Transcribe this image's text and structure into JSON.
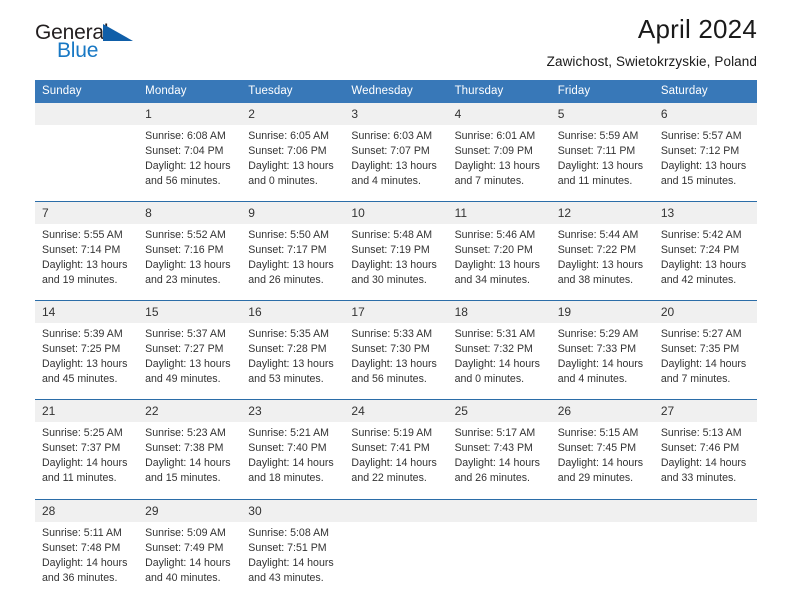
{
  "brand": {
    "name_part1": "General",
    "name_part2": "Blue",
    "logo_icon": "triangle-icon",
    "color_dark": "#231f20",
    "color_blue": "#1878c4"
  },
  "header": {
    "title": "April 2024",
    "subtitle": "Zawichost, Swietokrzyskie, Poland"
  },
  "calendar": {
    "header_bg": "#3878b8",
    "daynum_bg": "#f0f0f0",
    "weekday_headers": [
      "Sunday",
      "Monday",
      "Tuesday",
      "Wednesday",
      "Thursday",
      "Friday",
      "Saturday"
    ],
    "weeks": [
      {
        "days": [
          {
            "num": "",
            "sunrise": "",
            "sunset": "",
            "daylight_1": "",
            "daylight_2": ""
          },
          {
            "num": "1",
            "sunrise": "Sunrise: 6:08 AM",
            "sunset": "Sunset: 7:04 PM",
            "daylight_1": "Daylight: 12 hours",
            "daylight_2": "and 56 minutes."
          },
          {
            "num": "2",
            "sunrise": "Sunrise: 6:05 AM",
            "sunset": "Sunset: 7:06 PM",
            "daylight_1": "Daylight: 13 hours",
            "daylight_2": "and 0 minutes."
          },
          {
            "num": "3",
            "sunrise": "Sunrise: 6:03 AM",
            "sunset": "Sunset: 7:07 PM",
            "daylight_1": "Daylight: 13 hours",
            "daylight_2": "and 4 minutes."
          },
          {
            "num": "4",
            "sunrise": "Sunrise: 6:01 AM",
            "sunset": "Sunset: 7:09 PM",
            "daylight_1": "Daylight: 13 hours",
            "daylight_2": "and 7 minutes."
          },
          {
            "num": "5",
            "sunrise": "Sunrise: 5:59 AM",
            "sunset": "Sunset: 7:11 PM",
            "daylight_1": "Daylight: 13 hours",
            "daylight_2": "and 11 minutes."
          },
          {
            "num": "6",
            "sunrise": "Sunrise: 5:57 AM",
            "sunset": "Sunset: 7:12 PM",
            "daylight_1": "Daylight: 13 hours",
            "daylight_2": "and 15 minutes."
          }
        ]
      },
      {
        "days": [
          {
            "num": "7",
            "sunrise": "Sunrise: 5:55 AM",
            "sunset": "Sunset: 7:14 PM",
            "daylight_1": "Daylight: 13 hours",
            "daylight_2": "and 19 minutes."
          },
          {
            "num": "8",
            "sunrise": "Sunrise: 5:52 AM",
            "sunset": "Sunset: 7:16 PM",
            "daylight_1": "Daylight: 13 hours",
            "daylight_2": "and 23 minutes."
          },
          {
            "num": "9",
            "sunrise": "Sunrise: 5:50 AM",
            "sunset": "Sunset: 7:17 PM",
            "daylight_1": "Daylight: 13 hours",
            "daylight_2": "and 26 minutes."
          },
          {
            "num": "10",
            "sunrise": "Sunrise: 5:48 AM",
            "sunset": "Sunset: 7:19 PM",
            "daylight_1": "Daylight: 13 hours",
            "daylight_2": "and 30 minutes."
          },
          {
            "num": "11",
            "sunrise": "Sunrise: 5:46 AM",
            "sunset": "Sunset: 7:20 PM",
            "daylight_1": "Daylight: 13 hours",
            "daylight_2": "and 34 minutes."
          },
          {
            "num": "12",
            "sunrise": "Sunrise: 5:44 AM",
            "sunset": "Sunset: 7:22 PM",
            "daylight_1": "Daylight: 13 hours",
            "daylight_2": "and 38 minutes."
          },
          {
            "num": "13",
            "sunrise": "Sunrise: 5:42 AM",
            "sunset": "Sunset: 7:24 PM",
            "daylight_1": "Daylight: 13 hours",
            "daylight_2": "and 42 minutes."
          }
        ]
      },
      {
        "days": [
          {
            "num": "14",
            "sunrise": "Sunrise: 5:39 AM",
            "sunset": "Sunset: 7:25 PM",
            "daylight_1": "Daylight: 13 hours",
            "daylight_2": "and 45 minutes."
          },
          {
            "num": "15",
            "sunrise": "Sunrise: 5:37 AM",
            "sunset": "Sunset: 7:27 PM",
            "daylight_1": "Daylight: 13 hours",
            "daylight_2": "and 49 minutes."
          },
          {
            "num": "16",
            "sunrise": "Sunrise: 5:35 AM",
            "sunset": "Sunset: 7:28 PM",
            "daylight_1": "Daylight: 13 hours",
            "daylight_2": "and 53 minutes."
          },
          {
            "num": "17",
            "sunrise": "Sunrise: 5:33 AM",
            "sunset": "Sunset: 7:30 PM",
            "daylight_1": "Daylight: 13 hours",
            "daylight_2": "and 56 minutes."
          },
          {
            "num": "18",
            "sunrise": "Sunrise: 5:31 AM",
            "sunset": "Sunset: 7:32 PM",
            "daylight_1": "Daylight: 14 hours",
            "daylight_2": "and 0 minutes."
          },
          {
            "num": "19",
            "sunrise": "Sunrise: 5:29 AM",
            "sunset": "Sunset: 7:33 PM",
            "daylight_1": "Daylight: 14 hours",
            "daylight_2": "and 4 minutes."
          },
          {
            "num": "20",
            "sunrise": "Sunrise: 5:27 AM",
            "sunset": "Sunset: 7:35 PM",
            "daylight_1": "Daylight: 14 hours",
            "daylight_2": "and 7 minutes."
          }
        ]
      },
      {
        "days": [
          {
            "num": "21",
            "sunrise": "Sunrise: 5:25 AM",
            "sunset": "Sunset: 7:37 PM",
            "daylight_1": "Daylight: 14 hours",
            "daylight_2": "and 11 minutes."
          },
          {
            "num": "22",
            "sunrise": "Sunrise: 5:23 AM",
            "sunset": "Sunset: 7:38 PM",
            "daylight_1": "Daylight: 14 hours",
            "daylight_2": "and 15 minutes."
          },
          {
            "num": "23",
            "sunrise": "Sunrise: 5:21 AM",
            "sunset": "Sunset: 7:40 PM",
            "daylight_1": "Daylight: 14 hours",
            "daylight_2": "and 18 minutes."
          },
          {
            "num": "24",
            "sunrise": "Sunrise: 5:19 AM",
            "sunset": "Sunset: 7:41 PM",
            "daylight_1": "Daylight: 14 hours",
            "daylight_2": "and 22 minutes."
          },
          {
            "num": "25",
            "sunrise": "Sunrise: 5:17 AM",
            "sunset": "Sunset: 7:43 PM",
            "daylight_1": "Daylight: 14 hours",
            "daylight_2": "and 26 minutes."
          },
          {
            "num": "26",
            "sunrise": "Sunrise: 5:15 AM",
            "sunset": "Sunset: 7:45 PM",
            "daylight_1": "Daylight: 14 hours",
            "daylight_2": "and 29 minutes."
          },
          {
            "num": "27",
            "sunrise": "Sunrise: 5:13 AM",
            "sunset": "Sunset: 7:46 PM",
            "daylight_1": "Daylight: 14 hours",
            "daylight_2": "and 33 minutes."
          }
        ]
      },
      {
        "days": [
          {
            "num": "28",
            "sunrise": "Sunrise: 5:11 AM",
            "sunset": "Sunset: 7:48 PM",
            "daylight_1": "Daylight: 14 hours",
            "daylight_2": "and 36 minutes."
          },
          {
            "num": "29",
            "sunrise": "Sunrise: 5:09 AM",
            "sunset": "Sunset: 7:49 PM",
            "daylight_1": "Daylight: 14 hours",
            "daylight_2": "and 40 minutes."
          },
          {
            "num": "30",
            "sunrise": "Sunrise: 5:08 AM",
            "sunset": "Sunset: 7:51 PM",
            "daylight_1": "Daylight: 14 hours",
            "daylight_2": "and 43 minutes."
          },
          {
            "num": "",
            "sunrise": "",
            "sunset": "",
            "daylight_1": "",
            "daylight_2": ""
          },
          {
            "num": "",
            "sunrise": "",
            "sunset": "",
            "daylight_1": "",
            "daylight_2": ""
          },
          {
            "num": "",
            "sunrise": "",
            "sunset": "",
            "daylight_1": "",
            "daylight_2": ""
          },
          {
            "num": "",
            "sunrise": "",
            "sunset": "",
            "daylight_1": "",
            "daylight_2": ""
          }
        ]
      }
    ]
  }
}
